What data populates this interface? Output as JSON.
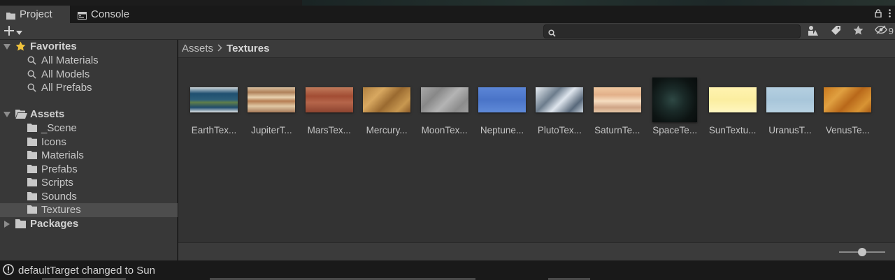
{
  "tabs": [
    {
      "label": "Project",
      "icon": "folder-icon",
      "active": true
    },
    {
      "label": "Console",
      "icon": "console-icon",
      "active": false
    }
  ],
  "toolbar": {
    "create_icon": "plus-icon",
    "search_value": "",
    "hidden_count": "9"
  },
  "tree": {
    "favorites": {
      "label": "Favorites",
      "items": [
        "All Materials",
        "All Models",
        "All Prefabs"
      ]
    },
    "assets": {
      "label": "Assets",
      "items": [
        "_Scene",
        "Icons",
        "Materials",
        "Prefabs",
        "Scripts",
        "Sounds",
        "Textures"
      ],
      "selected": "Textures"
    },
    "packages": {
      "label": "Packages"
    }
  },
  "breadcrumb": {
    "root": "Assets",
    "current": "Textures"
  },
  "assets_grid": [
    {
      "name": "EarthTex...",
      "fill": "linear-gradient(180deg,#cfd8dc 0%,#1f4f70 25%,#2d5f7a 50%,#5f7e4a 60%,#1e4a6a 80%,#e4e8ea 100%)"
    },
    {
      "name": "JupiterT...",
      "fill": "linear-gradient(180deg,#d9c0a0 0%,#b0825a 20%,#e8d2b0 40%,#b57d52 55%,#e0c8a4 75%,#a67a5a 100%)"
    },
    {
      "name": "MarsTex...",
      "fill": "linear-gradient(180deg,#c07a5a 0%,#a24d34 35%,#b5654a 60%,#8d4430 100%)"
    },
    {
      "name": "Mercury...",
      "fill": "linear-gradient(135deg,#b08040 0%,#d8a860 30%,#9a6a30 55%,#c89850 80%,#8a5a28 100%)"
    },
    {
      "name": "MoonTex...",
      "fill": "linear-gradient(135deg,#a8a8a8 0%,#888 30%,#b4b4b4 55%,#8c8c8c 80%,#9e9e9e 100%)"
    },
    {
      "name": "Neptune...",
      "fill": "linear-gradient(180deg,#5b86d6 0%,#4a74c8 50%,#5f8ad8 100%)"
    },
    {
      "name": "PlutoTex...",
      "fill": "linear-gradient(135deg,#e8eef4 0%,#6c7c8c 35%,#dfe6ee 55%,#58687a 80%,#c8d2dc 100%)"
    },
    {
      "name": "SaturnTe...",
      "fill": "linear-gradient(180deg,#f0c8a0 0%,#e2b08a 30%,#f6dcc0 55%,#cfa486 80%,#e8c8a8 100%)"
    },
    {
      "name": "SpaceTe...",
      "fill": "radial-gradient(circle at 45% 50%,#2e4844 0%,#1a2a28 35%,#0d1413 70%,#080c0c 100%)",
      "square": true
    },
    {
      "name": "SunTextu...",
      "fill": "linear-gradient(180deg,#fff3b0 0%,#fbeea0 50%,#fff6c0 100%)"
    },
    {
      "name": "UranusT...",
      "fill": "linear-gradient(180deg,#b4cfe0 0%,#a8c6da 50%,#b8d2e2 100%)"
    },
    {
      "name": "VenusTe...",
      "fill": "linear-gradient(135deg,#c8781e 0%,#e0a040 30%,#b8681a 55%,#d89434 80%,#a85a14 100%)"
    }
  ],
  "zoom_level": 0.5,
  "status": {
    "icon": "warning-icon",
    "text": "defaultTarget changed to Sun"
  }
}
